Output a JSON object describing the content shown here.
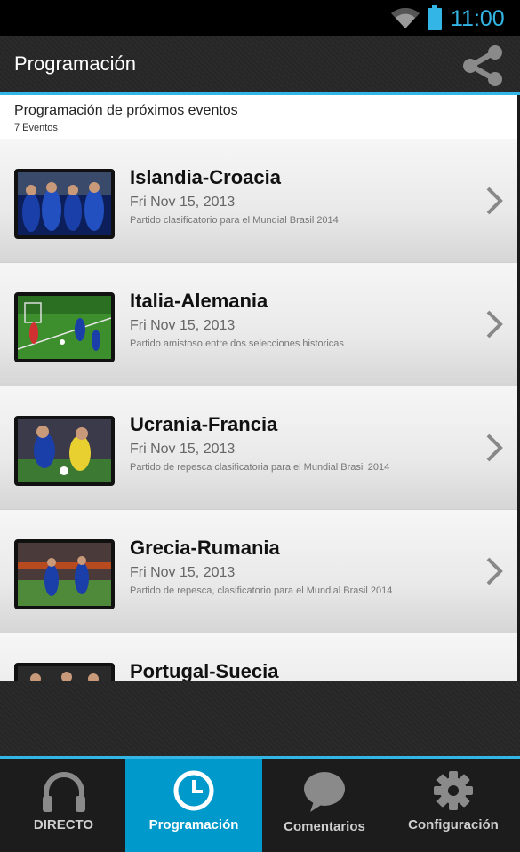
{
  "status_bar": {
    "time": "11:00"
  },
  "action_bar": {
    "title": "Programación",
    "share_icon": "share-icon"
  },
  "header": {
    "title": "Programación de próximos eventos",
    "count": "7 Eventos"
  },
  "events": [
    {
      "name": "Islandia-Croacia",
      "date": "Fri Nov 15, 2013",
      "description": "Partido clasificatorio para el Mundial Brasil 2014"
    },
    {
      "name": "Italia-Alemania",
      "date": "Fri Nov 15, 2013",
      "description": "Partido amistoso entre dos selecciones historicas"
    },
    {
      "name": "Ucrania-Francia",
      "date": "Fri Nov 15, 2013",
      "description": "Partido de repesca clasificatoria para el Mundial Brasil 2014"
    },
    {
      "name": "Grecia-Rumania",
      "date": "Fri Nov 15, 2013",
      "description": "Partido de repesca, clasificatorio para el Mundial Brasil 2014"
    },
    {
      "name": "Portugal-Suecia",
      "date": "",
      "description": ""
    }
  ],
  "tabs": [
    {
      "label": "DIRECTO",
      "icon": "headphones-icon",
      "active": false
    },
    {
      "label": "Programación",
      "icon": "clock-icon",
      "active": true
    },
    {
      "label": "Comentarios",
      "icon": "speech-bubble-icon",
      "active": false
    },
    {
      "label": "Configuración",
      "icon": "gear-icon",
      "active": false
    }
  ],
  "colors": {
    "accent": "#33b5e5",
    "active_tab": "#0099cc"
  }
}
